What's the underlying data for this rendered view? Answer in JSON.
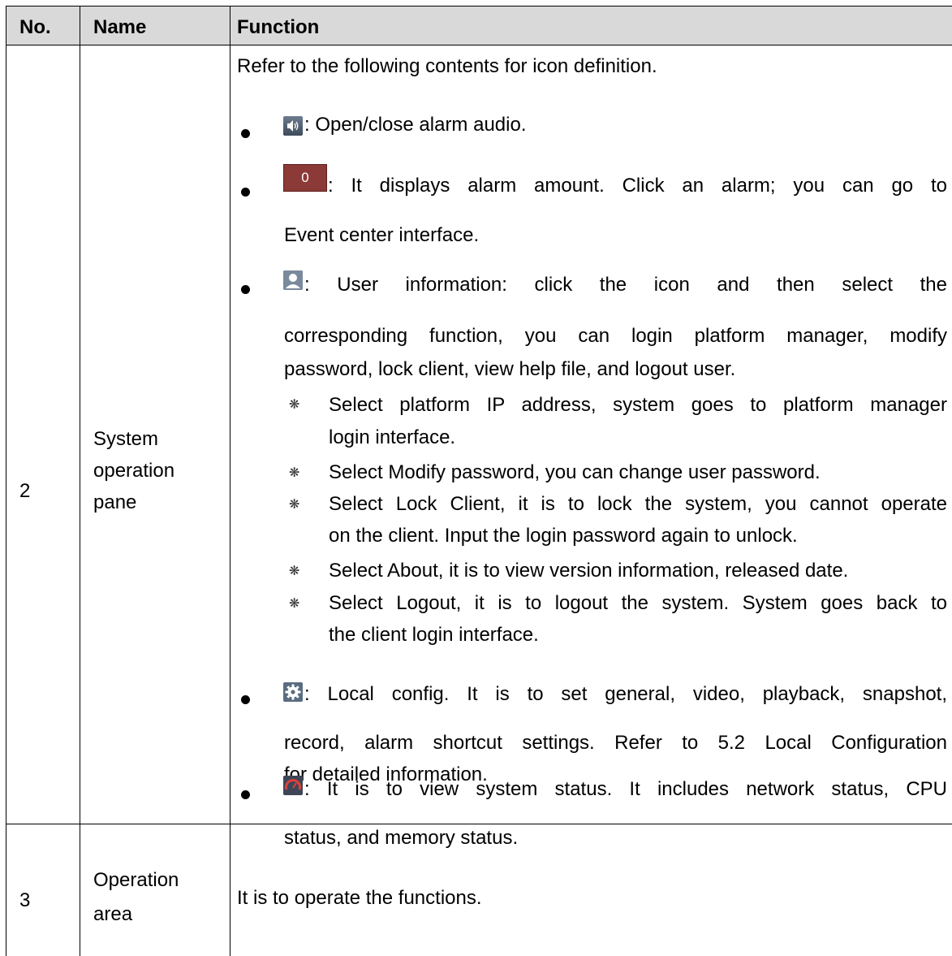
{
  "table": {
    "headers": {
      "no": "No.",
      "name": "Name",
      "function": "Function"
    },
    "row2": {
      "no": "2",
      "name_lines": [
        "System",
        "operation",
        "pane"
      ],
      "intro": "Refer to the following contents for icon definition.",
      "audio_text": ": Open/close alarm audio.",
      "alarm_badge": "0",
      "alarm_line1": ": It displays alarm amount. Click an alarm; you can go to",
      "alarm_line2": "Event center interface.",
      "user_line1": ": User information: click the icon and then select the",
      "user_line2": "corresponding function, you can login platform manager, modify",
      "user_line3": "password, lock client, view help file, and logout user.",
      "sub1_line1": "Select platform IP address, system goes to platform manager",
      "sub1_line2": "login interface.",
      "sub2_line1": "Select Modify password, you can change user password.",
      "sub3_line1": "Select Lock Client, it is to lock the system, you cannot operate",
      "sub3_line2": "on the client. Input the login password again to unlock.",
      "sub4_line1": "Select About, it is to view version information, released date.",
      "sub5_line1": "Select Logout, it is to logout the system. System goes back to",
      "sub5_line2": "the client login interface.",
      "config_line1": ": Local config. It is to set general, video, playback, snapshot,",
      "config_line2": "record, alarm shortcut settings. Refer to 5.2 Local Configuration",
      "config_line3": "for detailed information.",
      "status_line1": ": It is to view system status. It includes network status, CPU",
      "status_line2": "status, and memory status."
    },
    "row3": {
      "no": "3",
      "name_lines": [
        "Operation",
        "area"
      ],
      "function": "It is to operate the functions."
    }
  },
  "icons": [
    "speaker-icon",
    "alarm-count-badge",
    "user-icon",
    "gear-icon",
    "gauge-icon"
  ],
  "colors": {
    "header_bg": "#d9d9d9",
    "alarm_badge_bg": "#8c3a37",
    "gauge_red": "#e0403a"
  }
}
